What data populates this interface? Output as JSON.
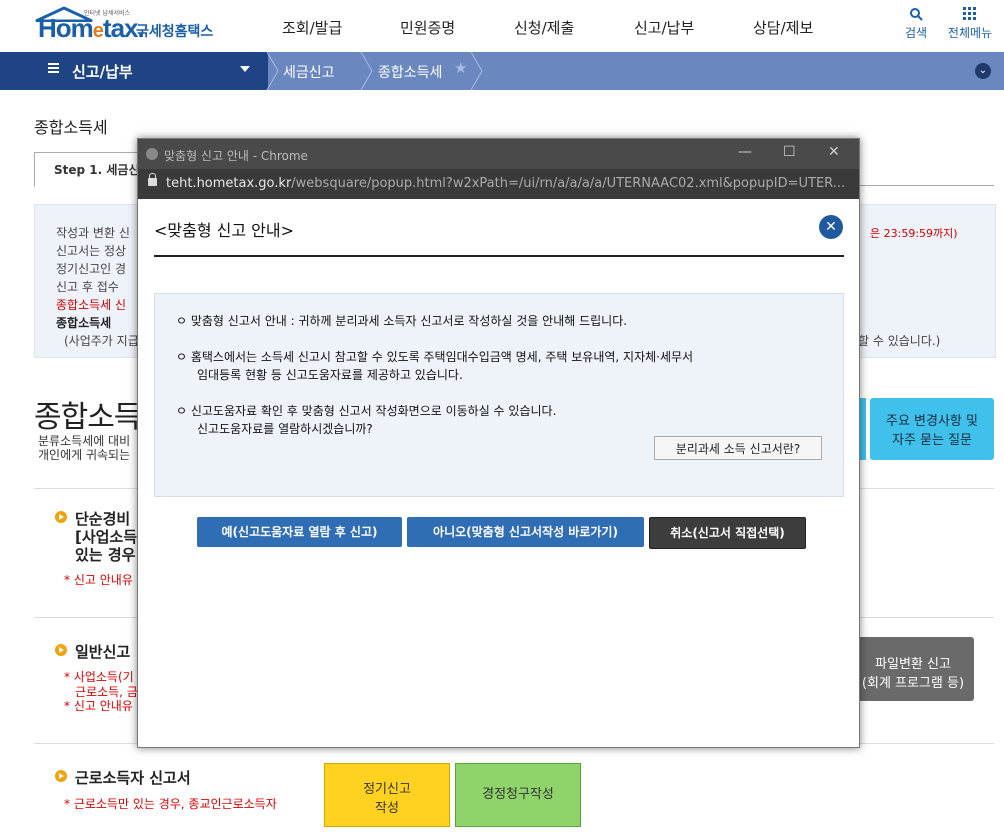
{
  "header": {
    "logo_small": "인터넷 납세서비스",
    "logo_word_a": "Hom",
    "logo_word_e": "e",
    "logo_word_b": "tax.",
    "logo_kor": "국세청홈택스",
    "gnb": [
      "조회/발급",
      "민원증명",
      "신청/제출",
      "신고/납부",
      "상담/제보"
    ],
    "search_label": "검색",
    "allmenu_label": "전체메뉴"
  },
  "navbar": {
    "title": "신고/납부",
    "crumb1": "세금신고",
    "crumb2": "종합소득세"
  },
  "page": {
    "title": "종합소득세",
    "step_tab": "Step 1. 세금신",
    "info": [
      "작성과 변환 신",
      "신고서는 정상",
      "정기신고인 경",
      "신고 후 접수",
      "종합소득세 신",
      "종합소득세 ",
      "(사업주가 지급"
    ],
    "info_red_right": "은 23:59:59까지)",
    "info_right2": "할 수 있습니다.)",
    "big_title": "종합소득",
    "big_desc1": "분류소득세에 대비",
    "big_desc2": "개인에게 귀속되는",
    "faq_button": "주요 변경사항 및\n자주 묻는 질문",
    "sec1_title": "단순경비",
    "sec1_title2": "[사업소득",
    "sec1_title3": "있는 경우",
    "sec1_red": "* 신고 안내유",
    "sec2_title": "일반신고",
    "sec2_red1": "* 사업소득(기",
    "sec2_red2": "근로소득, 금",
    "sec2_red3": "* 신고 안내유",
    "file_button": "파일변환 신고\n(회계 프로그램 등)",
    "sec3_title": "근로소득자 신고서",
    "sec3_red": "* 근로소득만 있는 경우, 종교인근로소득자",
    "regular_button": "정기신고\n작성",
    "correction_button": "경정청구작성"
  },
  "popup": {
    "window_title": "맞춤형 신고 안내 - Chrome",
    "url_host": "teht.hometax.go.kr",
    "url_rest": "/websquare/popup.html?w2xPath=/ui/rn/a/a/a/a/UTERNAAC02.xml&popupID=UTER...",
    "heading": "<맞춤형 신고 안내>",
    "line1": "ㅇ 맞춤형 신고서 안내 : 귀하께 분리과세 소득자 신고서로 작성하실 것을 안내해 드립니다.",
    "line2a": "ㅇ 홈택스에서는 소득세 신고시 참고할 수 있도록 주택임대수입금액 명세, 주택 보유내역, 지자체·세무서",
    "line2b": "임대등록 현황 등 신고도움자료를 제공하고 있습니다.",
    "line3a": "ㅇ 신고도움자료 확인 후 맞춤형 신고서 작성화면으로 이동하실 수 있습니다.",
    "line3b": "신고도움자료를 열람하시겠습니까?",
    "info_button": "분리과세 소득 신고서란?",
    "btn_yes": "예(신고도움자료 열람 후 신고)",
    "btn_no": "아니오(맞춤형 신고서작성 바로가기)",
    "btn_cancel": "취소(신고서 직접선택)"
  },
  "colors": {
    "brand_blue": "#1b5fa8",
    "nav_dark": "#1f4483",
    "nav_light": "#6b87c0",
    "button_blue": "#2f6db5",
    "button_dark": "#3d3d3d"
  }
}
